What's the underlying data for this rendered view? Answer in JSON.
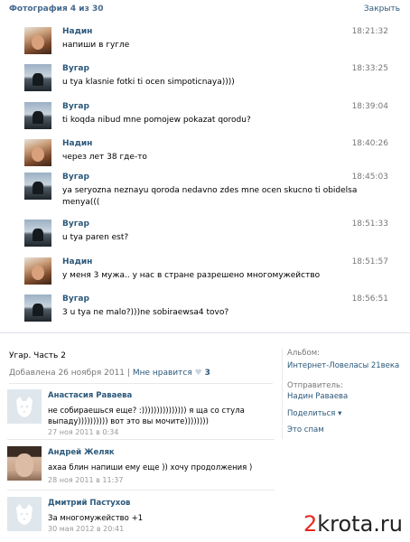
{
  "header": {
    "title": "Фотография 4 из 30",
    "close_label": "Закрыть"
  },
  "messages": [
    {
      "author": "Надин",
      "time": "18:21:32",
      "text": "напиши в гугле",
      "avatar": "nadin"
    },
    {
      "author": "Вугар",
      "time": "18:33:25",
      "text": "u tya klasnie fotki ti ocen simpoticnaya))))",
      "avatar": "vugar"
    },
    {
      "author": "Вугар",
      "time": "18:39:04",
      "text": "ti koqda nibud mne pomojew pokazat qorodu?",
      "avatar": "vugar"
    },
    {
      "author": "Надин",
      "time": "18:40:26",
      "text": "через лет 38 где-то",
      "avatar": "nadin"
    },
    {
      "author": "Вугар",
      "time": "18:45:03",
      "text": "ya seryozna neznayu qoroda nedavno zdes mne ocen skucno ti obidelsa menya(((",
      "avatar": "vugar"
    },
    {
      "author": "Вугар",
      "time": "18:51:33",
      "text": "u tya paren est?",
      "avatar": "vugar"
    },
    {
      "author": "Надин",
      "time": "18:51:57",
      "text": "у меня 3 мужа.. у нас в стране разрешено многомужейство",
      "avatar": "nadin"
    },
    {
      "author": "Вугар",
      "time": "18:56:51",
      "text": "3 u tya ne malo?)))ne sobiraewsa4 tovo?",
      "avatar": "vugar"
    }
  ],
  "post": {
    "title": "Угар. Часть 2",
    "added": "Добавлена 26 ноября 2011",
    "separator": "|",
    "like_label": "Мне нравится",
    "like_count": "3"
  },
  "sidebar": {
    "album_label": "Альбом:",
    "album_value": "Интернет-Ловеласы 21века",
    "sender_label": "Отправитель:",
    "sender_value": "Надин Раваева",
    "share_label": "Поделиться",
    "share_arrow": "▾",
    "spam_label": "Это спам"
  },
  "comments": [
    {
      "author": "Анастасия Раваева",
      "text": "не собираешься еще? :))))))))))))))) я ща со стула выпаду)))))))))) вот это вы мочите))))))))",
      "date": "27 ноя 2011 в 0:34",
      "avatar": "deleted"
    },
    {
      "author": "Андрей Желяк",
      "text": "ахаа блин напиши ему еще )) хочу продолжения )",
      "date": "28 ноя 2011 в 11:37",
      "avatar": "photo"
    },
    {
      "author": "Дмитрий Пастухов",
      "text": "За многомужейство +1",
      "date": "30 мая 2012 в 20:41",
      "avatar": "deleted"
    }
  ],
  "watermark": {
    "part1": "2",
    "part2": "krota.ru"
  }
}
